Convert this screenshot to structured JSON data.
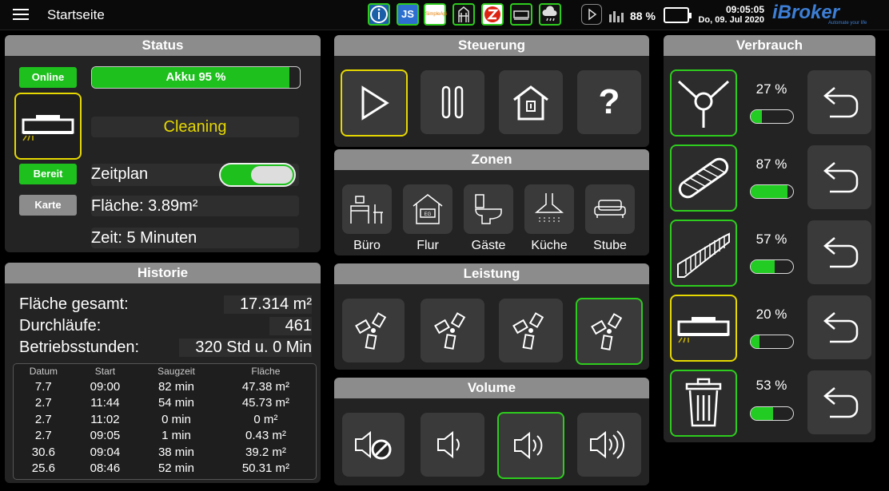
{
  "header": {
    "title": "Startseite",
    "battery_percent": "88 %",
    "time": "09:05:05",
    "date": "Do, 09. Jul 2020",
    "brand": "iBroker",
    "brand_tagline": "Automate your life"
  },
  "status": {
    "title": "Status",
    "online": "Online",
    "akku_label": "Akku 95 %",
    "akku_level": 0.95,
    "state": "Cleaning",
    "bereit": "Bereit",
    "zeitplan": "Zeitplan",
    "zeitplan_on": true,
    "karte": "Karte",
    "flaeche": "Fläche: 3.89m²",
    "zeit": "Zeit: 5 Minuten"
  },
  "historie": {
    "title": "Historie",
    "summary": [
      {
        "label": "Fläche gesamt:",
        "value": "17.314 m²"
      },
      {
        "label": "Durchläufe:",
        "value": "461"
      },
      {
        "label": "Betriebsstunden:",
        "value": "320 Std u. 0 Min"
      }
    ],
    "columns": [
      "Datum",
      "Start",
      "Saugzeit",
      "Fläche"
    ],
    "rows": [
      [
        "7.7",
        "09:00",
        "82 min",
        "47.38 m²"
      ],
      [
        "2.7",
        "11:44",
        "54 min",
        "45.73 m²"
      ],
      [
        "2.7",
        "11:02",
        "0 min",
        "0 m²"
      ],
      [
        "2.7",
        "09:05",
        "1 min",
        "0.43 m²"
      ],
      [
        "30.6",
        "09:04",
        "38 min",
        "39.2 m²"
      ],
      [
        "25.6",
        "08:46",
        "52 min",
        "50.31 m²"
      ]
    ]
  },
  "steuerung": {
    "title": "Steuerung"
  },
  "zonen": {
    "title": "Zonen",
    "items": [
      "Büro",
      "Flur",
      "Gäste",
      "Küche",
      "Stube"
    ]
  },
  "leistung": {
    "title": "Leistung"
  },
  "volume": {
    "title": "Volume"
  },
  "verbrauch": {
    "title": "Verbrauch",
    "items": [
      {
        "percent": "27 %",
        "level": 0.27
      },
      {
        "percent": "87 %",
        "level": 0.87
      },
      {
        "percent": "57 %",
        "level": 0.57
      },
      {
        "percent": "20 %",
        "level": 0.2
      },
      {
        "percent": "53 %",
        "level": 0.53
      }
    ]
  },
  "colors": {
    "accent_green": "#2ecc1e",
    "accent_yellow": "#e6d800",
    "header_grey": "#8c8c8c"
  }
}
